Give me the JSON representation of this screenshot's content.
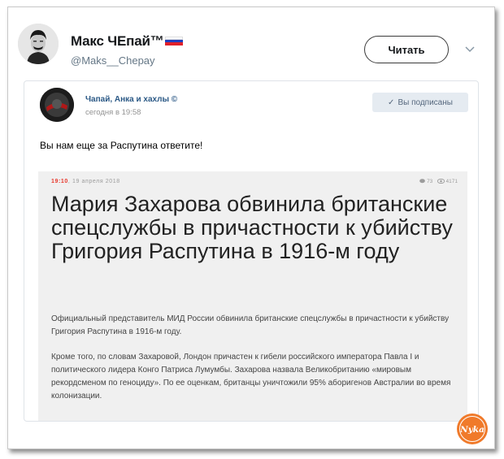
{
  "tweet": {
    "user_name": "Макс ЧЕпай™",
    "user_handle": "@Maks__Chepay",
    "follow_label": "Читать",
    "flag_colors": [
      "#ffffff",
      "#1f3fbf",
      "#e0202a"
    ]
  },
  "embed": {
    "group_name": "Чапай, Анка и хахлы ©",
    "time": "сегодня в 19:58",
    "subscribed_label": "Вы подписаны",
    "post_text": "Вы нам еще за Распутина ответите!",
    "article": {
      "time": "19:10",
      "date": "19 апреля 2018",
      "comments": "73",
      "views": "4171",
      "headline": "Мария Захарова обвинила британские спецслужбы в причастности к убийству Григория Распутина в 1916-м году",
      "paragraph1": "Официальный представитель МИД России обвинила британские спецслужбы в причастности к убийству Григория Распутина в 1916-м году.",
      "paragraph2": "Кроме того, по словам Захаровой, Лондон причастен к гибели российского императора Павла I и политического лидера Конго Патриса Лумумбы. Захарова назвала Великобританию «мировым рекордсменом по геноциду». По ее оценкам, британцы уничтожили 95% аборигенов Австралии во время колонизации."
    }
  },
  "watermark": {
    "text": "Nyka"
  },
  "icons": [
    "user-avatar-icon",
    "chevron-down-icon",
    "group-avatar-icon",
    "check-icon",
    "comment-icon",
    "eye-icon"
  ],
  "colors": {
    "link": "#2a5885",
    "accent_red": "#e8372c",
    "badge": "#f07a2a"
  }
}
